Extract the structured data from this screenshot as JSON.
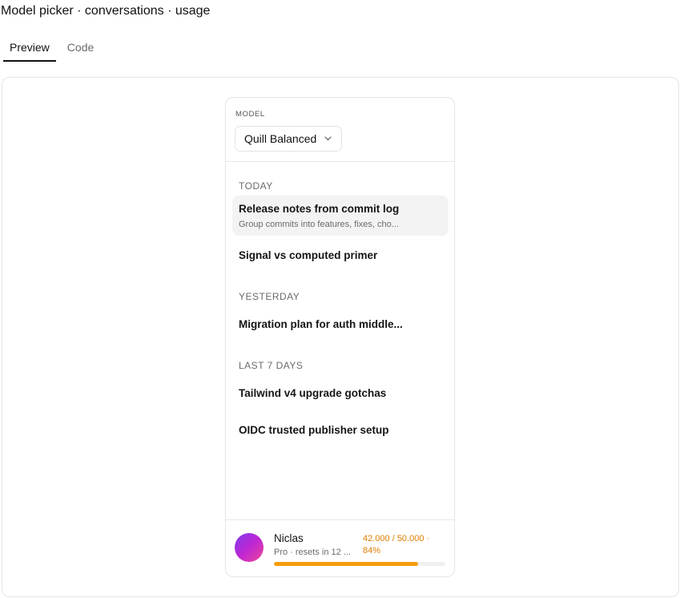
{
  "page": {
    "title": "Model picker · conversations · usage"
  },
  "tabs": [
    {
      "label": "Preview",
      "active": true
    },
    {
      "label": "Code",
      "active": false
    }
  ],
  "model": {
    "label": "MODEL",
    "selected": "Quill Balanced",
    "icon": "chevron-down-icon"
  },
  "groups": [
    {
      "header": "TODAY",
      "items": [
        {
          "title": "Release notes from commit log",
          "subtitle": "Group commits into features, fixes, cho...",
          "active": true
        },
        {
          "title": "Signal vs computed primer"
        }
      ]
    },
    {
      "header": "YESTERDAY",
      "items": [
        {
          "title": "Migration plan for auth middle..."
        }
      ]
    },
    {
      "header": "LAST 7 DAYS",
      "items": [
        {
          "title": "Tailwind v4 upgrade gotchas"
        },
        {
          "title": "OIDC trusted publisher setup"
        }
      ]
    }
  ],
  "user": {
    "name": "Niclas",
    "plan": "Pro · resets in 12 ...",
    "usage_line1": "42.000 / 50.000 ·",
    "usage_line2": "84%",
    "usage_fraction": 0.84
  },
  "colors": {
    "accent": "#f59e0b",
    "usage_text": "#e07d00",
    "active_row": "#f3f3f3",
    "avatar_from": "#7c3aed",
    "avatar_to": "#ec4899"
  }
}
